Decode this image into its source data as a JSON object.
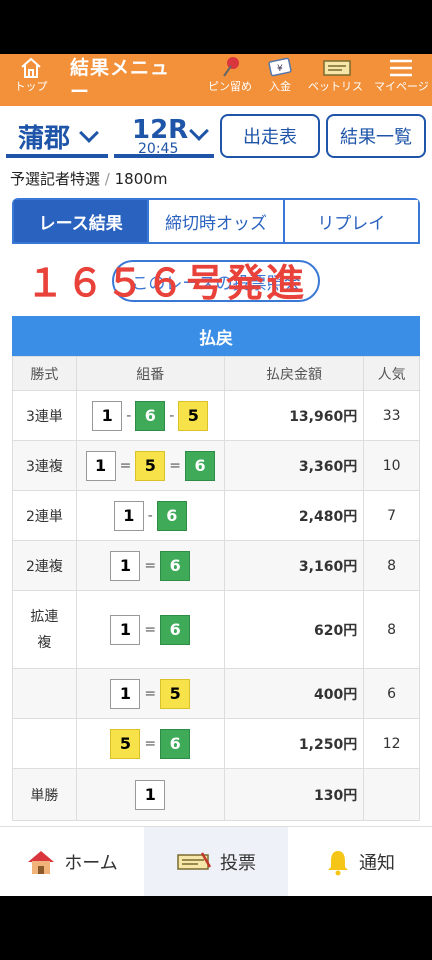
{
  "nav": {
    "home_label": "トップ",
    "title": "結果メニュー",
    "items": [
      {
        "label": "ピン留めレース",
        "icon": "pin-icon"
      },
      {
        "label": "入金",
        "icon": "yen-card-icon"
      },
      {
        "label": "ベットリスト",
        "icon": "ticket-icon"
      },
      {
        "label": "マイページ",
        "icon": "menu-icon"
      }
    ]
  },
  "selector": {
    "venue": "蒲郡",
    "race": "12R",
    "time": "20:45",
    "btn_entries": "出走表",
    "btn_results": "結果一覧"
  },
  "race_info": {
    "name": "予選記者特選",
    "separator": "/",
    "distance": "1800m"
  },
  "tabs": [
    "レース結果",
    "締切時オッズ",
    "リプレイ"
  ],
  "vote_link": "このレースの投票照会",
  "overlay": "１６５６号発進",
  "payout": {
    "title": "払戻",
    "headers": [
      "勝式",
      "組番",
      "払戻金額",
      "人気"
    ],
    "rows": [
      {
        "type": "3連単",
        "boats": [
          "1",
          "6",
          "5"
        ],
        "op": "-",
        "amount": "13,960円",
        "pop": "33"
      },
      {
        "type": "3連複",
        "boats": [
          "1",
          "5",
          "6"
        ],
        "op": "=",
        "amount": "3,360円",
        "pop": "10"
      },
      {
        "type": "2連単",
        "boats": [
          "1",
          "6"
        ],
        "op": "-",
        "amount": "2,480円",
        "pop": "7"
      },
      {
        "type": "2連複",
        "boats": [
          "1",
          "6"
        ],
        "op": "=",
        "amount": "3,160円",
        "pop": "8"
      },
      {
        "type": "拡連複",
        "boats": [
          "1",
          "6"
        ],
        "op": "=",
        "amount": "620円",
        "pop": "8"
      },
      {
        "type": "",
        "boats": [
          "1",
          "5"
        ],
        "op": "=",
        "amount": "400円",
        "pop": "6"
      },
      {
        "type": "",
        "boats": [
          "5",
          "6"
        ],
        "op": "=",
        "amount": "1,250円",
        "pop": "12"
      },
      {
        "type": "単勝",
        "boats": [
          "1"
        ],
        "op": "",
        "amount": "130円",
        "pop": ""
      }
    ]
  },
  "bottom": {
    "home": "ホーム",
    "vote": "投票",
    "notify": "通知"
  },
  "colors": {
    "accent": "#f3903a",
    "brand": "#1e55a8",
    "highlight": "#e8423a"
  }
}
